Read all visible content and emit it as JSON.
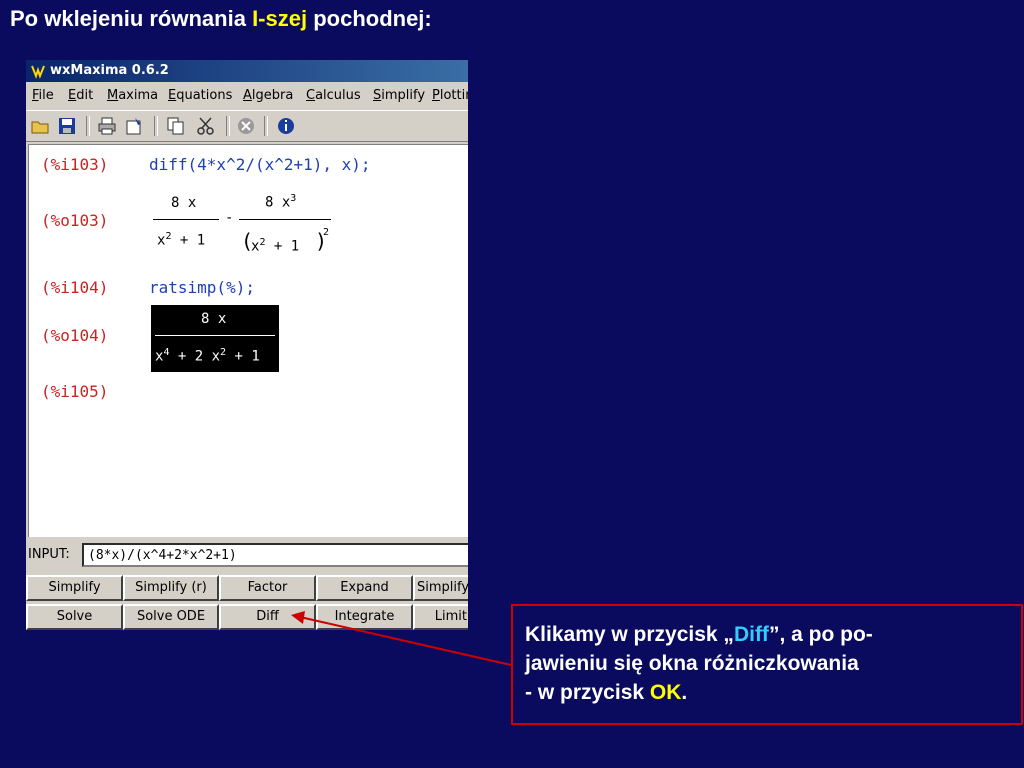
{
  "slide": {
    "title_before": "Po wklejeniu równania ",
    "title_highlight": "I-szej",
    "title_after": " pochodnej:"
  },
  "window": {
    "title": "wxMaxima 0.6.2",
    "menu": [
      "File",
      "Edit",
      "Maxima",
      "Equations",
      "Algebra",
      "Calculus",
      "Simplify",
      "Plotting"
    ],
    "toolbar_icons": [
      "open-icon",
      "save-icon",
      "print-icon",
      "config-icon",
      "copy-icon",
      "cut-icon",
      "interrupt-icon",
      "help-icon"
    ]
  },
  "worksheet": {
    "cells": [
      {
        "label": "(%i103)",
        "input": "diff(4*x^2/(x^2+1), x);"
      },
      {
        "label": "(%o103)",
        "frac1_num": "8 x",
        "frac1_den_base": "x",
        "frac1_den_exp": "2",
        "frac1_den_rest": " + 1",
        "minus": "-",
        "frac2_num_base": "8 x",
        "frac2_num_exp": "3",
        "frac2_den_inner_base": "x",
        "frac2_den_inner_exp": "2",
        "frac2_den_inner_rest": " + 1",
        "frac2_den_outer_exp": "2"
      },
      {
        "label": "(%i104)",
        "input": "ratsimp(%);"
      },
      {
        "label": "(%o104)",
        "num": "8 x",
        "den_t1_base": "x",
        "den_t1_exp": "4",
        "den_mid": " + 2 x",
        "den_t2_exp": "2",
        "den_end": " + 1"
      },
      {
        "label": "(%i105)"
      }
    ]
  },
  "input_bar": {
    "label": "INPUT:",
    "value": "(8*x)/(x^4+2*x^2+1)"
  },
  "buttons": {
    "row1": [
      "Simplify",
      "Simplify (r)",
      "Factor",
      "Expand",
      "Simplify"
    ],
    "row2": [
      "Solve",
      "Solve ODE",
      "Diff",
      "Integrate",
      "Limit"
    ]
  },
  "callout": {
    "t1": "Klikamy w przycisk „",
    "diff": "Diff",
    "t2": "”, a po po-",
    "t3": "jawieniu się okna różniczkowania",
    "t4": "- w przycisk ",
    "ok": "OK",
    "t5": "."
  },
  "colors": {
    "background": "#0a0a5e",
    "highlight_yellow": "#ffff00",
    "highlight_cyan": "#33ccff",
    "callout_border": "#cc0000",
    "label_red": "#cc2222",
    "input_blue": "#1f3fb5"
  }
}
